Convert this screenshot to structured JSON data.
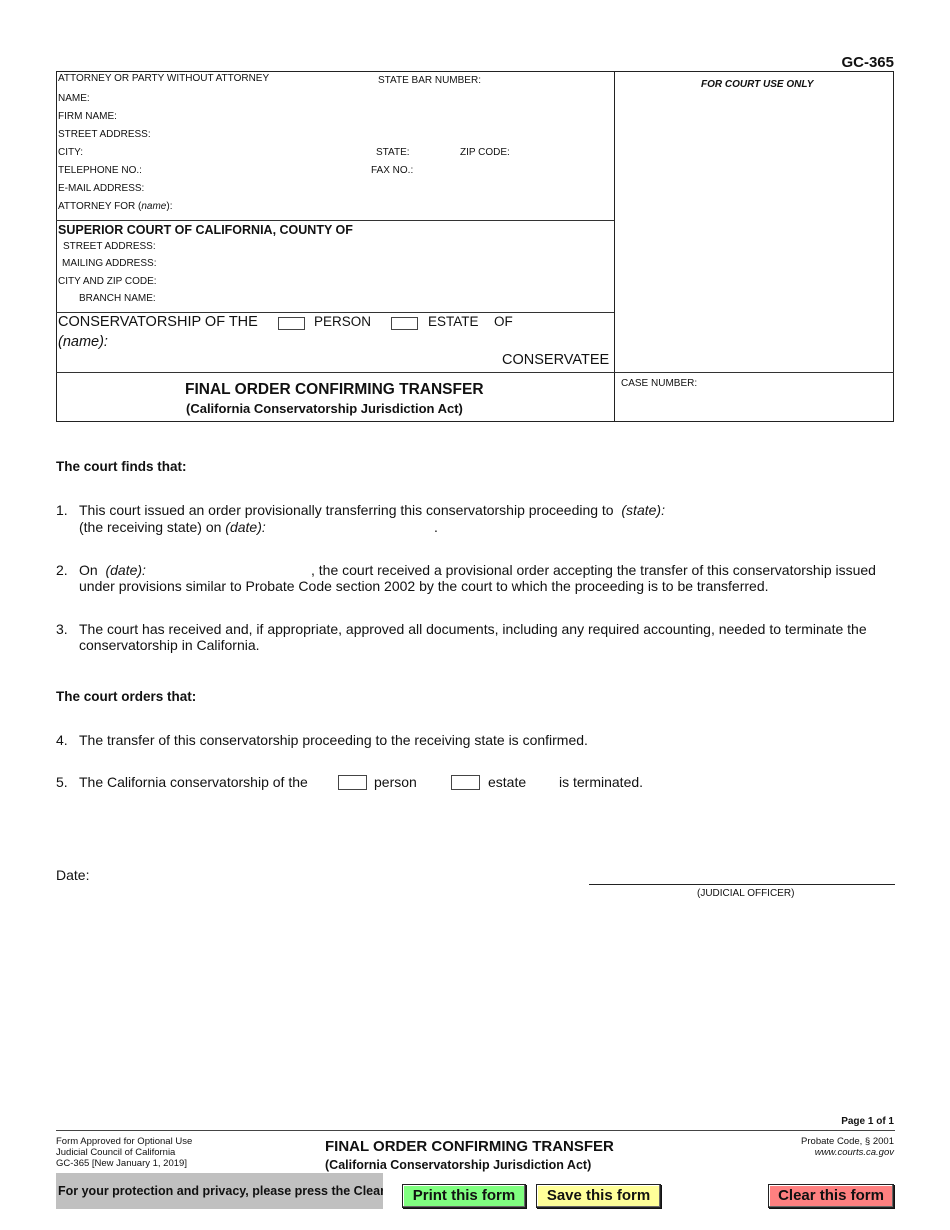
{
  "form_id": "GC-365",
  "attorney_section": {
    "header": "ATTORNEY OR PARTY WITHOUT ATTORNEY",
    "state_bar_number": "STATE BAR NUMBER:",
    "name": "NAME:",
    "firm_name": "FIRM NAME:",
    "street_address": "STREET ADDRESS:",
    "city": "CITY:",
    "state": "STATE:",
    "zip_code": "ZIP CODE:",
    "telephone": "TELEPHONE NO.:",
    "fax": "FAX NO.:",
    "email": "E-MAIL ADDRESS:",
    "attorney_for_prefix": "ATTORNEY FOR (",
    "attorney_for_italic": "name",
    "attorney_for_suffix": "):"
  },
  "court_use_only": "FOR COURT USE ONLY",
  "court_section": {
    "title": "SUPERIOR COURT OF CALIFORNIA, COUNTY OF",
    "street_address": "STREET ADDRESS:",
    "mailing_address": "MAILING ADDRESS:",
    "city_zip": "CITY AND ZIP CODE:",
    "branch_name": "BRANCH NAME:"
  },
  "case_caption": {
    "conservatorship_of_the": "CONSERVATORSHIP OF THE",
    "person": "PERSON",
    "estate": "ESTATE",
    "of": "OF",
    "name_label": "(name):",
    "conservatee": "CONSERVATEE",
    "person_checked": false,
    "estate_checked": false
  },
  "form_title": {
    "main": "FINAL ORDER CONFIRMING TRANSFER",
    "sub": "(California Conservatorship Jurisdiction Act)"
  },
  "case_number_label": "CASE NUMBER:",
  "findings": {
    "heading": "The court finds that:",
    "items": [
      {
        "num": "1.",
        "line1": "This court issued an order provisionally transferring this conservatorship proceeding to",
        "state_label": "(state):",
        "line2_prefix": "(the receiving state) on",
        "date_label": "(date):",
        "line2_suffix": "."
      },
      {
        "num": "2.",
        "prefix": "On",
        "date_label": "(date):",
        "line1": ", the court received a provisional order accepting the transfer of this conservatorship issued",
        "line2": "under provisions similar to Probate Code section 2002 by the court to which the proceeding is to be transferred."
      },
      {
        "num": "3.",
        "line1": "The court has received and, if appropriate, approved all documents, including any required accounting, needed to terminate the",
        "line2": "conservatorship in California."
      }
    ]
  },
  "orders": {
    "heading": "The court orders that:",
    "items": [
      {
        "num": "4.",
        "text": "The transfer of this conservatorship proceeding to the receiving state is confirmed."
      },
      {
        "num": "5.",
        "text": "The California conservatorship of the",
        "person": "person",
        "estate": "estate",
        "suffix": "is terminated.",
        "person_checked": false,
        "estate_checked": false
      }
    ]
  },
  "date_label": "Date:",
  "judicial_officer": "(JUDICIAL OFFICER)",
  "footer": {
    "page": "Page 1 of 1",
    "approved": "Form Approved for Optional Use",
    "council": "Judicial Council of California",
    "revision": "GC-365 [New January 1, 2019]",
    "title": "FINAL ORDER CONFIRMING TRANSFER",
    "subtitle": "(California Conservatorship Jurisdiction Act)",
    "code": "Probate Code, § 2001",
    "website": "www.courts.ca.gov"
  },
  "actions": {
    "privacy_notice": "For your protection and privacy, please press the Clear",
    "print": "Print this form",
    "save": "Save this form",
    "clear": "Clear this form",
    "colors": {
      "print": "#80ff80",
      "save": "#ffff99",
      "clear": "#ff8080",
      "privacy_bg": "#c0c0c0"
    }
  }
}
